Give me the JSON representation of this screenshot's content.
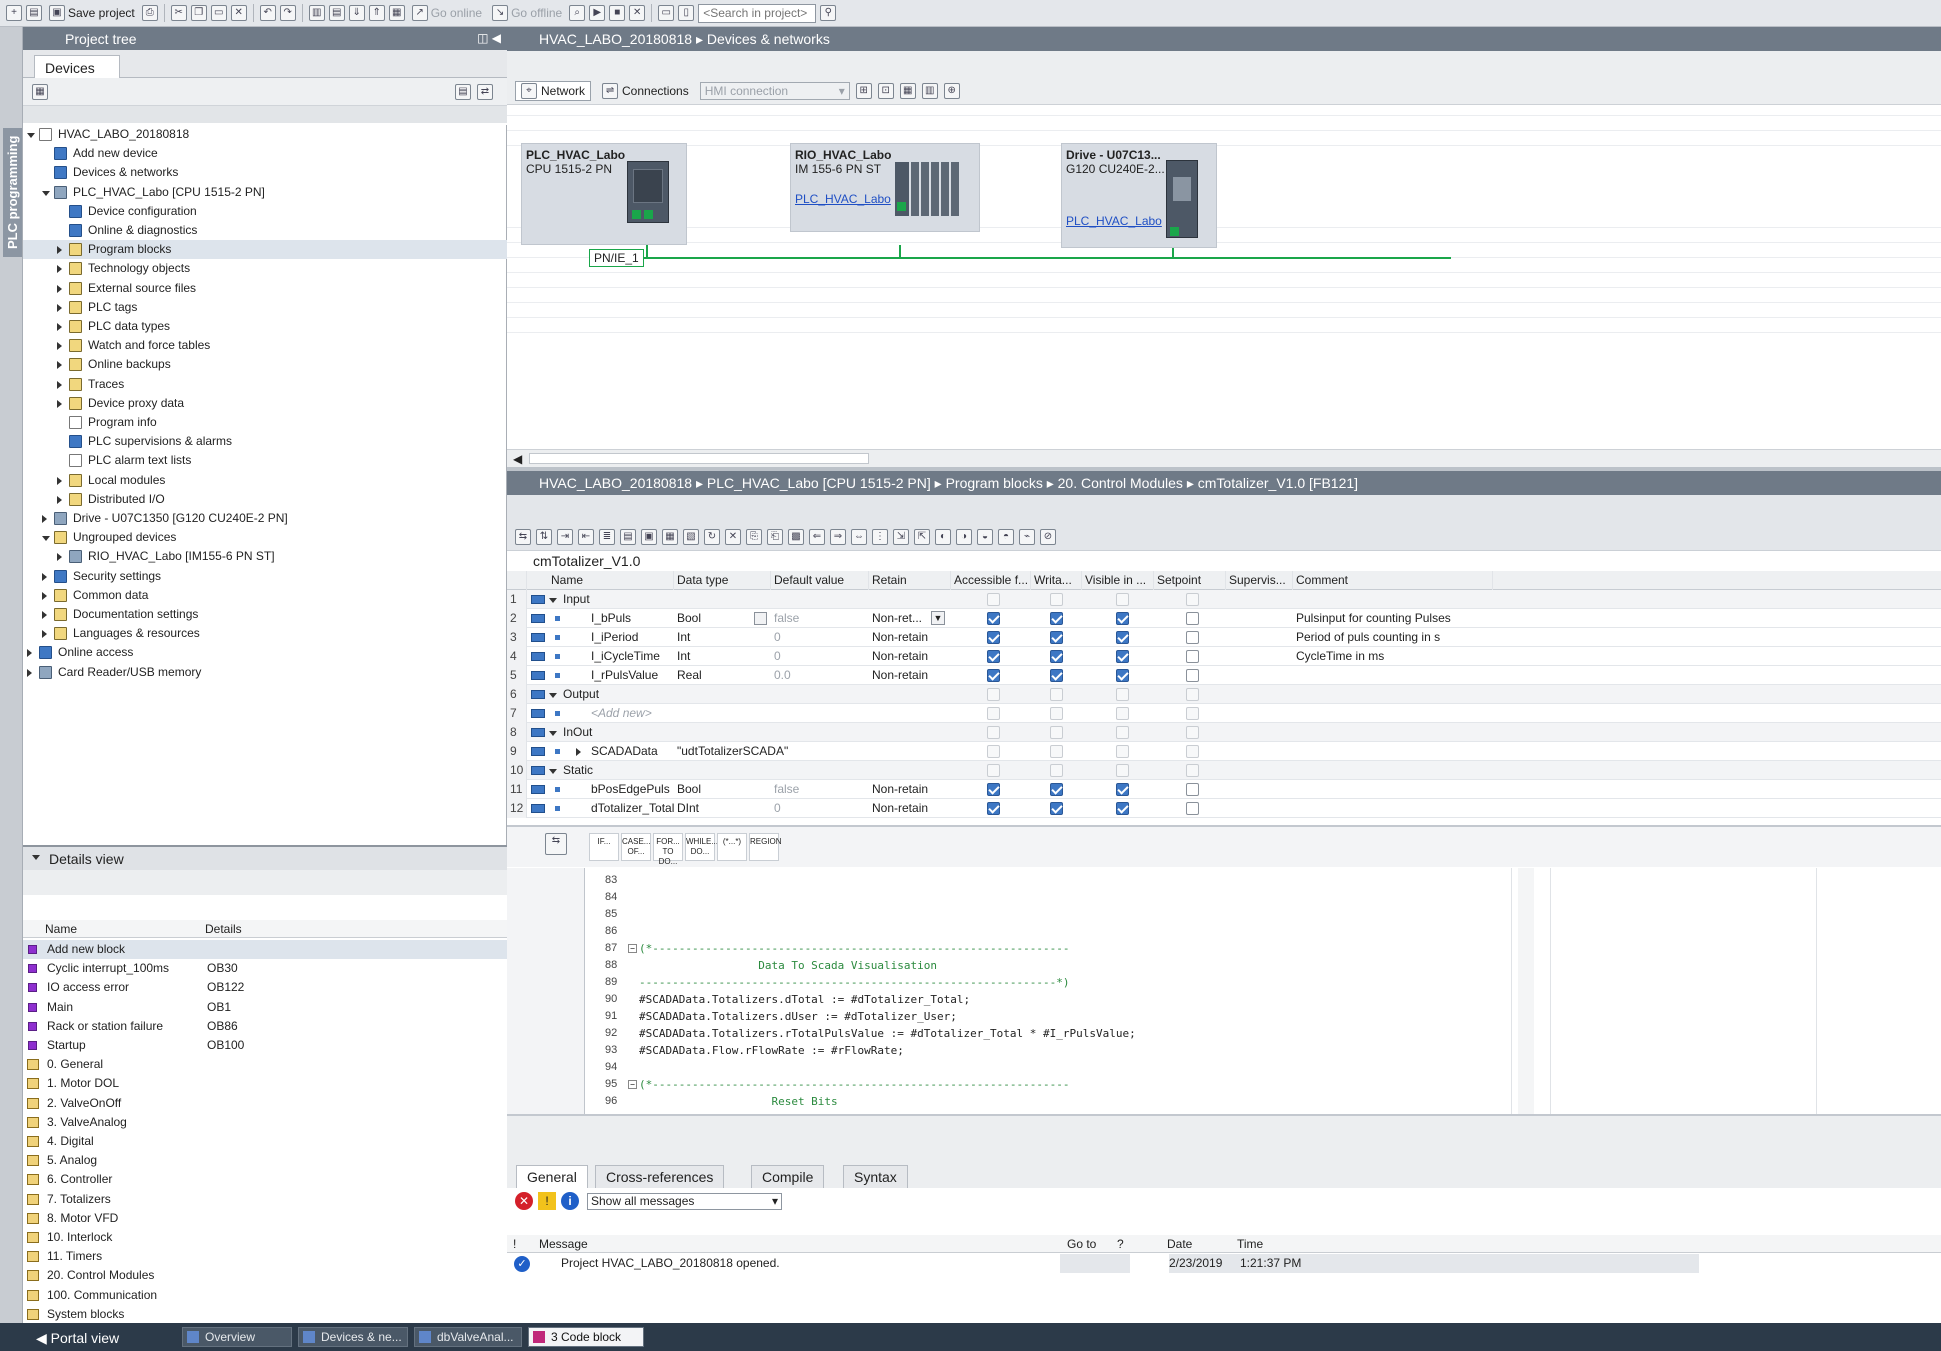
{
  "toolbar": {
    "save_project": "Save project",
    "go_online": "Go online",
    "go_offline": "Go offline",
    "search_placeholder": "<Search in project>"
  },
  "side_strip": {
    "label": "PLC programming"
  },
  "project_tree": {
    "title": "Project tree",
    "tab": "Devices",
    "items": [
      {
        "label": "HVAC_LABO_20180818",
        "indent": 0,
        "expander": "down",
        "icon": "project-icon"
      },
      {
        "label": "Add new device",
        "indent": 1,
        "expander": "none",
        "icon": "add-device-icon"
      },
      {
        "label": "Devices & networks",
        "indent": 1,
        "expander": "none",
        "icon": "network-icon"
      },
      {
        "label": "PLC_HVAC_Labo [CPU 1515-2 PN]",
        "indent": 1,
        "expander": "down",
        "icon": "cpu-icon"
      },
      {
        "label": "Device configuration",
        "indent": 2,
        "expander": "none",
        "icon": "device-config-icon"
      },
      {
        "label": "Online & diagnostics",
        "indent": 2,
        "expander": "none",
        "icon": "diagnostics-icon"
      },
      {
        "label": "Program blocks",
        "indent": 2,
        "expander": "right",
        "icon": "folder-icon",
        "selected": true
      },
      {
        "label": "Technology objects",
        "indent": 2,
        "expander": "right",
        "icon": "folder-icon"
      },
      {
        "label": "External source files",
        "indent": 2,
        "expander": "right",
        "icon": "folder-icon"
      },
      {
        "label": "PLC tags",
        "indent": 2,
        "expander": "right",
        "icon": "folder-icon"
      },
      {
        "label": "PLC data types",
        "indent": 2,
        "expander": "right",
        "icon": "folder-icon"
      },
      {
        "label": "Watch and force tables",
        "indent": 2,
        "expander": "right",
        "icon": "folder-icon"
      },
      {
        "label": "Online backups",
        "indent": 2,
        "expander": "right",
        "icon": "folder-icon"
      },
      {
        "label": "Traces",
        "indent": 2,
        "expander": "right",
        "icon": "folder-icon"
      },
      {
        "label": "Device proxy data",
        "indent": 2,
        "expander": "right",
        "icon": "folder-icon"
      },
      {
        "label": "Program info",
        "indent": 2,
        "expander": "none",
        "icon": "program-info-icon"
      },
      {
        "label": "PLC supervisions & alarms",
        "indent": 2,
        "expander": "none",
        "icon": "alarm-icon"
      },
      {
        "label": "PLC alarm text lists",
        "indent": 2,
        "expander": "none",
        "icon": "text-list-icon"
      },
      {
        "label": "Local modules",
        "indent": 2,
        "expander": "right",
        "icon": "folder-icon"
      },
      {
        "label": "Distributed I/O",
        "indent": 2,
        "expander": "right",
        "icon": "folder-icon"
      },
      {
        "label": "Drive - U07C1350 [G120 CU240E-2 PN]",
        "indent": 1,
        "expander": "right",
        "icon": "drive-icon"
      },
      {
        "label": "Ungrouped devices",
        "indent": 1,
        "expander": "down",
        "icon": "folder-icon"
      },
      {
        "label": "RIO_HVAC_Labo [IM155-6 PN ST]",
        "indent": 2,
        "expander": "right",
        "icon": "io-device-icon"
      },
      {
        "label": "Security settings",
        "indent": 1,
        "expander": "right",
        "icon": "security-icon"
      },
      {
        "label": "Common data",
        "indent": 1,
        "expander": "right",
        "icon": "folder-icon"
      },
      {
        "label": "Documentation settings",
        "indent": 1,
        "expander": "right",
        "icon": "folder-icon"
      },
      {
        "label": "Languages & resources",
        "indent": 1,
        "expander": "right",
        "icon": "folder-icon"
      },
      {
        "label": "Online access",
        "indent": 0,
        "expander": "right",
        "icon": "online-access-icon"
      },
      {
        "label": "Card Reader/USB memory",
        "indent": 0,
        "expander": "right",
        "icon": "card-reader-icon"
      }
    ]
  },
  "details_view": {
    "title": "Details view",
    "columns": [
      "Name",
      "Details"
    ],
    "rows": [
      {
        "name": "Add new block",
        "details": "",
        "icon": "add-block-icon"
      },
      {
        "name": "Cyclic interrupt_100ms",
        "details": "OB30",
        "icon": "ob-icon"
      },
      {
        "name": "IO access error",
        "details": "OB122",
        "icon": "ob-icon"
      },
      {
        "name": "Main",
        "details": "OB1",
        "icon": "ob-icon"
      },
      {
        "name": "Rack or station failure",
        "details": "OB86",
        "icon": "ob-icon"
      },
      {
        "name": "Startup",
        "details": "OB100",
        "icon": "ob-icon"
      },
      {
        "name": "0. General",
        "details": "",
        "icon": "folder-icon"
      },
      {
        "name": "1. Motor DOL",
        "details": "",
        "icon": "folder-icon"
      },
      {
        "name": "2. ValveOnOff",
        "details": "",
        "icon": "folder-icon"
      },
      {
        "name": "3. ValveAnalog",
        "details": "",
        "icon": "folder-icon"
      },
      {
        "name": "4. Digital",
        "details": "",
        "icon": "folder-icon"
      },
      {
        "name": "5. Analog",
        "details": "",
        "icon": "folder-icon"
      },
      {
        "name": "6. Controller",
        "details": "",
        "icon": "folder-icon"
      },
      {
        "name": "7. Totalizers",
        "details": "",
        "icon": "folder-icon"
      },
      {
        "name": "8. Motor VFD",
        "details": "",
        "icon": "folder-icon"
      },
      {
        "name": "10. Interlock",
        "details": "",
        "icon": "folder-icon"
      },
      {
        "name": "11. Timers",
        "details": "",
        "icon": "folder-icon"
      },
      {
        "name": "20. Control Modules",
        "details": "",
        "icon": "folder-icon"
      },
      {
        "name": "100. Communication",
        "details": "",
        "icon": "folder-icon"
      },
      {
        "name": "System blocks",
        "details": "",
        "icon": "folder-icon"
      }
    ]
  },
  "devices_networks": {
    "breadcrumb": [
      "HVAC_LABO_20180818",
      "Devices & networks"
    ],
    "network_btn": "Network",
    "connections_btn": "Connections",
    "connection_type": "HMI connection",
    "devices": [
      {
        "name": "PLC_HVAC_Labo",
        "type": "CPU 1515-2 PN",
        "link": ""
      },
      {
        "name": "RIO_HVAC_Labo",
        "type": "IM 155-6 PN ST",
        "link": "PLC_HVAC_Labo"
      },
      {
        "name": "Drive - U07C13...",
        "type": "G120 CU240E-2...",
        "link": "PLC_HVAC_Labo"
      }
    ],
    "subnet_label": "PN/IE_1",
    "subnet_color": "#1aa64a"
  },
  "code_block": {
    "breadcrumb": [
      "HVAC_LABO_20180818",
      "PLC_HVAC_Labo [CPU 1515-2 PN]",
      "Program blocks",
      "20. Control Modules",
      "cmTotalizer_V1.0 [FB121]"
    ],
    "block_title": "cmTotalizer_V1.0",
    "columns": [
      "",
      "Name",
      "Data type",
      "Default value",
      "Retain",
      "Accessible f...",
      "Writa...",
      "Visible in ...",
      "Setpoint",
      "Supervis...",
      "Comment"
    ],
    "rows": [
      {
        "no": "1",
        "name": "Input",
        "type": "",
        "def": "",
        "retain": "",
        "acc": false,
        "wr": false,
        "vis": false,
        "sp": false,
        "comment": "",
        "section": true
      },
      {
        "no": "2",
        "name": "I_bPuls",
        "type": "Bool",
        "def": "false",
        "retain": "Non-ret...",
        "acc": true,
        "wr": true,
        "vis": true,
        "sp": false,
        "comment": "Pulsinput for counting Pulses"
      },
      {
        "no": "3",
        "name": "I_iPeriod",
        "type": "Int",
        "def": "0",
        "retain": "Non-retain",
        "acc": true,
        "wr": true,
        "vis": true,
        "sp": false,
        "comment": "Period of puls counting in s"
      },
      {
        "no": "4",
        "name": "I_iCycleTime",
        "type": "Int",
        "def": "0",
        "retain": "Non-retain",
        "acc": true,
        "wr": true,
        "vis": true,
        "sp": false,
        "comment": "CycleTime in ms"
      },
      {
        "no": "5",
        "name": "I_rPulsValue",
        "type": "Real",
        "def": "0.0",
        "retain": "Non-retain",
        "acc": true,
        "wr": true,
        "vis": true,
        "sp": false,
        "comment": ""
      },
      {
        "no": "6",
        "name": "Output",
        "type": "",
        "def": "",
        "retain": "",
        "acc": false,
        "wr": false,
        "vis": false,
        "sp": false,
        "comment": "",
        "section": true
      },
      {
        "no": "7",
        "name": "<Add new>",
        "type": "",
        "def": "",
        "retain": "",
        "acc": false,
        "wr": false,
        "vis": false,
        "sp": false,
        "comment": "",
        "placeholder": true
      },
      {
        "no": "8",
        "name": "InOut",
        "type": "",
        "def": "",
        "retain": "",
        "acc": false,
        "wr": false,
        "vis": false,
        "sp": false,
        "comment": "",
        "section": true
      },
      {
        "no": "9",
        "name": "SCADAData",
        "type": "\"udtTotalizerSCADA\"",
        "def": "",
        "retain": "",
        "acc": false,
        "wr": false,
        "vis": false,
        "sp": false,
        "comment": ""
      },
      {
        "no": "10",
        "name": "Static",
        "type": "",
        "def": "",
        "retain": "",
        "acc": false,
        "wr": false,
        "vis": false,
        "sp": false,
        "comment": "",
        "section": true
      },
      {
        "no": "11",
        "name": "bPosEdgePuls",
        "type": "Bool",
        "def": "false",
        "retain": "Non-retain",
        "acc": true,
        "wr": true,
        "vis": true,
        "sp": false,
        "comment": ""
      },
      {
        "no": "12",
        "name": "dTotalizer_Total",
        "type": "DInt",
        "def": "0",
        "retain": "Non-retain",
        "acc": true,
        "wr": true,
        "vis": true,
        "sp": false,
        "comment": ""
      }
    ],
    "scl_buttons": [
      "IF...",
      "CASE... OF...",
      "FOR... TO DO...",
      "WHILE... DO...",
      "(*...*)",
      "REGION"
    ],
    "code_lines": [
      {
        "no": "83",
        "text": ""
      },
      {
        "no": "84",
        "text": ""
      },
      {
        "no": "85",
        "text": ""
      },
      {
        "no": "86",
        "text": ""
      },
      {
        "no": "87",
        "text": "(*---------------------------------------------------------------",
        "cls": "cmt"
      },
      {
        "no": "88",
        "text": "                  Data To Scada Visualisation",
        "cls": "cmt"
      },
      {
        "no": "89",
        "text": "---------------------------------------------------------------*)",
        "cls": "cmt"
      },
      {
        "no": "90",
        "text": "#SCADAData.Totalizers.dTotal := #dTotalizer_Total;"
      },
      {
        "no": "91",
        "text": "#SCADAData.Totalizers.dUser := #dTotalizer_User;"
      },
      {
        "no": "92",
        "text": "#SCADAData.Totalizers.rTotalPulsValue := #dTotalizer_Total * #I_rPulsValue;"
      },
      {
        "no": "93",
        "text": "#SCADAData.Flow.rFlowRate := #rFlowRate;"
      },
      {
        "no": "94",
        "text": ""
      },
      {
        "no": "95",
        "text": "(*---------------------------------------------------------------",
        "cls": "cmt"
      },
      {
        "no": "96",
        "text": "                    Reset Bits",
        "cls": "cmt"
      }
    ]
  },
  "messages": {
    "tabs": [
      "General",
      "Cross-references",
      "Compile",
      "Syntax"
    ],
    "filter": "Show all messages",
    "columns": [
      "!",
      "Message",
      "Go to",
      "?",
      "Date",
      "Time"
    ],
    "row": {
      "message": "Project HVAC_LABO_20180818 opened.",
      "date": "2/23/2019",
      "time": "1:21:37 PM"
    }
  },
  "statusbar": {
    "portal_view": "Portal view",
    "tabs": [
      "Overview",
      "Devices & ne...",
      "dbValveAnal...",
      "3 Code block"
    ]
  }
}
